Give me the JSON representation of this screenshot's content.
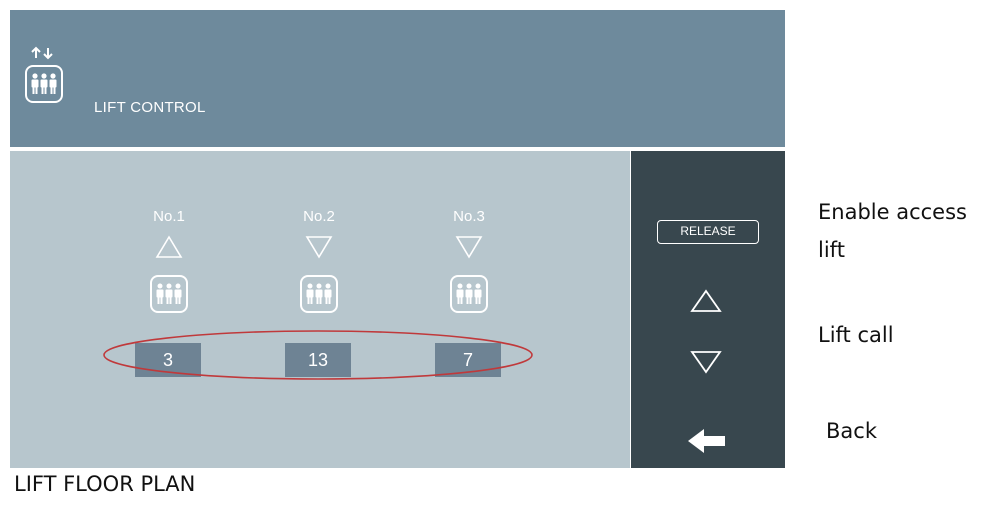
{
  "header": {
    "title": "LIFT CONTROL",
    "icon": "elevator-people-icon"
  },
  "lifts": [
    {
      "label": "No.1",
      "direction": "up",
      "floor": "3"
    },
    {
      "label": "No.2",
      "direction": "down",
      "floor": "13"
    },
    {
      "label": "No.3",
      "direction": "down",
      "floor": "7"
    }
  ],
  "sidebar": {
    "release_label": "RELEASE",
    "call_up_icon": "triangle-up-icon",
    "call_down_icon": "triangle-down-icon",
    "back_icon": "arrow-left-icon"
  },
  "annotations": {
    "enable_access_line1": "Enable access",
    "enable_access_line2": "lift",
    "lift_call": "Lift call",
    "back": "Back"
  },
  "caption": "LIFT FLOOR PLAN",
  "colors": {
    "header_bg": "#6e8a9c",
    "main_bg": "#b7c6cd",
    "sidebar_bg": "#38474e",
    "floor_box": "#6e8394",
    "highlight": "#c0393b"
  }
}
